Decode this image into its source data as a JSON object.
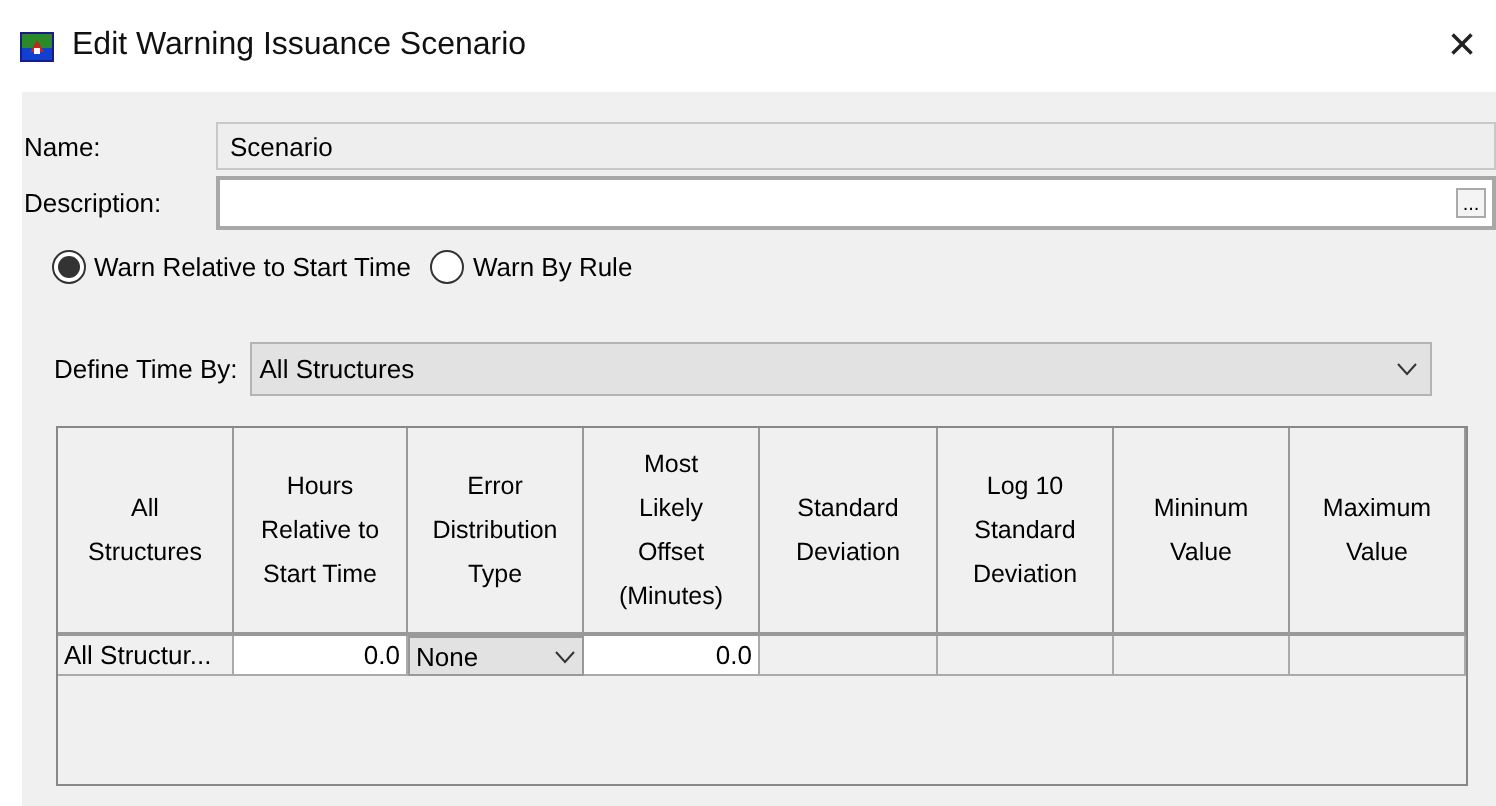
{
  "window": {
    "title": "Edit Warning Issuance Scenario",
    "close": "×"
  },
  "name": {
    "label": "Name:",
    "value": "Scenario"
  },
  "description": {
    "label": "Description:",
    "button": "..."
  },
  "modes": [
    {
      "label": "Warn Relative to Start Time",
      "selected": true
    },
    {
      "label": "Warn By Rule",
      "selected": false
    }
  ],
  "define_time_by": {
    "label": "Define Time By:",
    "value": "All Structures"
  },
  "table": {
    "columns": [
      "All\nStructures",
      "Hours\nRelative to\nStart Time",
      "Error\nDistribution\nType",
      "Most\nLikely\nOffset\n(Minutes)",
      "Standard\nDeviation",
      "Log 10\nStandard\nDeviation",
      "Mininum\nValue",
      "Maximum\nValue"
    ],
    "rows": [
      {
        "cells": [
          {
            "kind": "label",
            "text": "All Structur..."
          },
          {
            "kind": "number",
            "text": "0.0"
          },
          {
            "kind": "dropdown",
            "text": "None"
          },
          {
            "kind": "number",
            "text": "0.0"
          },
          {
            "kind": "empty"
          },
          {
            "kind": "empty"
          },
          {
            "kind": "empty"
          },
          {
            "kind": "empty"
          }
        ]
      }
    ]
  }
}
